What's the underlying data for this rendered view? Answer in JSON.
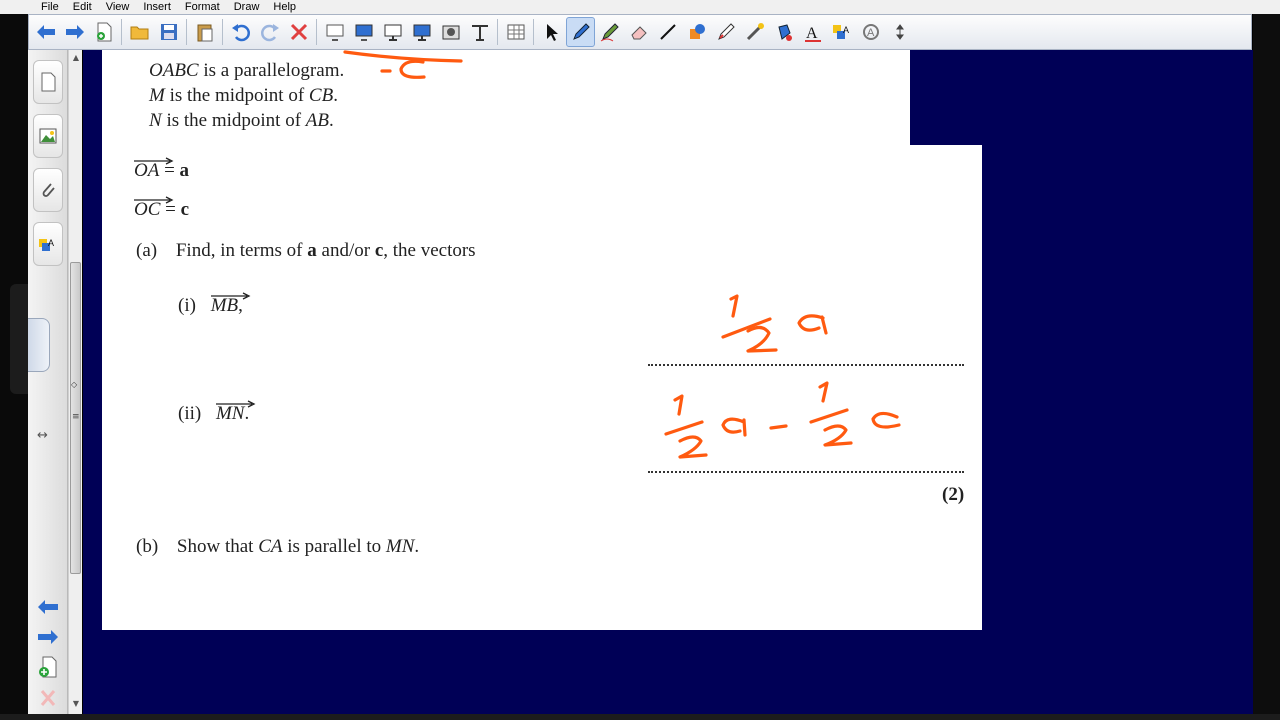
{
  "menu": [
    "File",
    "Edit",
    "View",
    "Insert",
    "Format",
    "Draw",
    "Help"
  ],
  "toolbar_icons": [
    "back-arrow-icon",
    "forward-arrow-icon",
    "add-page-icon",
    "open-folder-icon",
    "save-icon",
    "paste-icon",
    "undo-icon",
    "redo-icon",
    "delete-icon",
    "screen-shade-icon",
    "full-screen-icon",
    "display-icon",
    "projector-icon",
    "capture-icon",
    "screen-capture-icon",
    "table-icon",
    "select-icon",
    "pen-icon",
    "creative-pen-icon",
    "eraser-icon",
    "line-icon",
    "shapes-icon",
    "magic-pen-icon",
    "text-icon",
    "fill-icon",
    "font-icon",
    "properties-icon",
    "more-icon"
  ],
  "colors": {
    "canvas": "#000056",
    "ink": "#ff5a10",
    "accent": "#3a7bd5"
  },
  "question": {
    "line1_var": "OABC",
    "line1_text": " is a parallelogram.",
    "line2_var": "M",
    "line2_text": " is the midpoint of ",
    "line2_var2": "CB",
    "line2_end": ".",
    "line3_var": "N",
    "line3_text": " is the midpoint of ",
    "line3_var2": "AB",
    "line3_end": ".",
    "vec1_name": "OA",
    "vec1_eq": " = ",
    "vec1_val": "a",
    "vec2_name": "OC",
    "vec2_eq": " = ",
    "vec2_val": "c",
    "part_a_label": "(a)",
    "part_a_text1": "Find, in terms of ",
    "part_a_b1": "a",
    "part_a_text2": " and/or ",
    "part_a_b2": "c",
    "part_a_text3": ", the vectors",
    "part_i_label": "(i)",
    "part_i_vec": "MB",
    "part_i_end": ",",
    "part_ii_label": "(ii)",
    "part_ii_vec": "MN",
    "part_ii_end": ".",
    "marks": "(2)",
    "part_b_label": "(b)",
    "part_b_text1": "Show that ",
    "part_b_var1": "CA",
    "part_b_text2": " is parallel to ",
    "part_b_var2": "MN",
    "part_b_end": "."
  }
}
